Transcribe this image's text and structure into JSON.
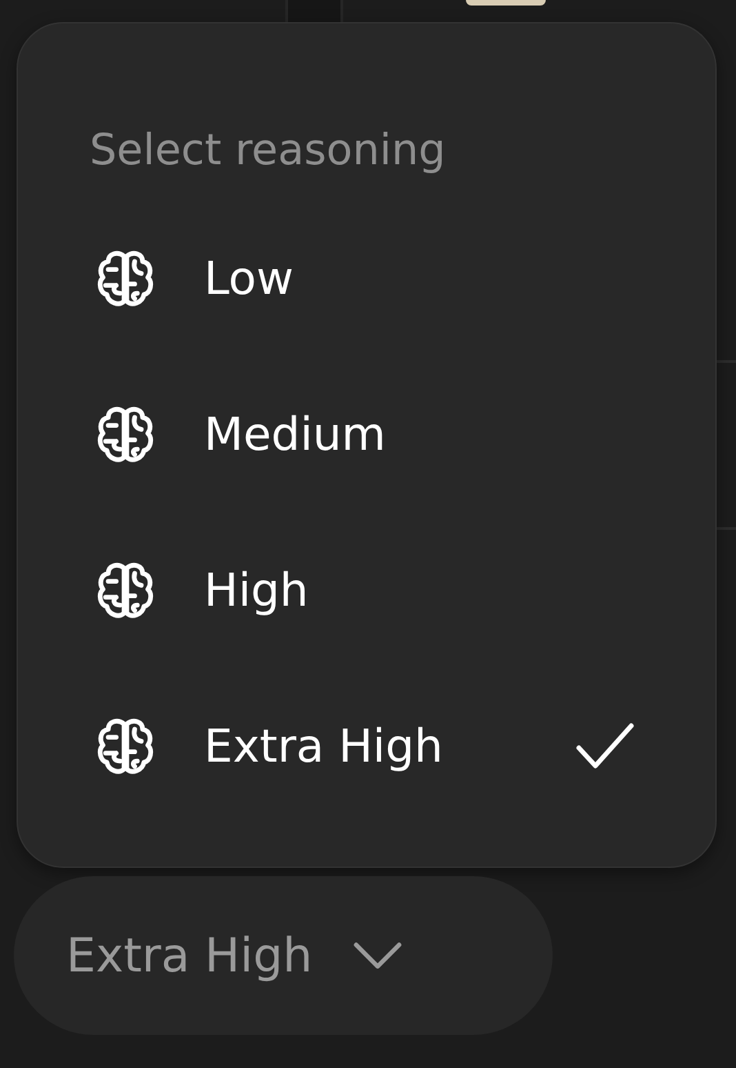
{
  "menu": {
    "title": "Select reasoning",
    "options": [
      {
        "label": "Low",
        "selected": false
      },
      {
        "label": "Medium",
        "selected": false
      },
      {
        "label": "High",
        "selected": false
      },
      {
        "label": "Extra High",
        "selected": true
      }
    ]
  },
  "button": {
    "label": "Extra High"
  }
}
